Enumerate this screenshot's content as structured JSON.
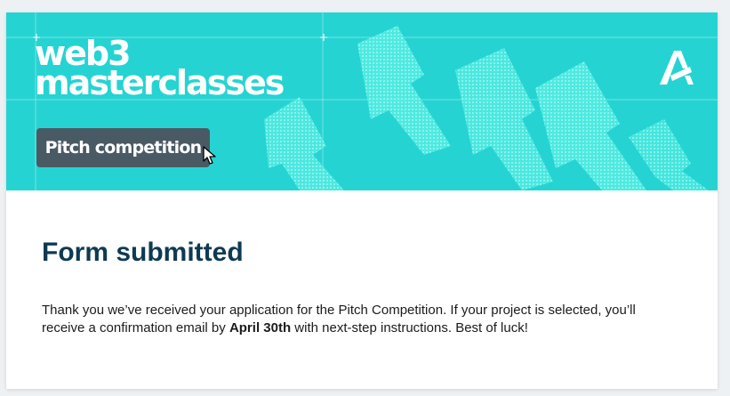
{
  "banner": {
    "brand_line1": "web3",
    "brand_line2": "masterclasses",
    "button_label": "Pitch competition",
    "logo_icon": "algorand-logo-icon",
    "cursor_icon": "pointer-cursor-icon",
    "background_color": "#25d4d2",
    "art_color": "#5ef0e6",
    "button_color": "#4a5a65"
  },
  "main": {
    "title": "Form submitted",
    "message_part1": "Thank you we’ve received your application for the Pitch Competition. If your project is selected, you’ll receive a confirmation email by ",
    "message_bold": "April 30th",
    "message_part2": " with next-step instructions. Best of luck!",
    "title_color": "#0e3a53"
  }
}
